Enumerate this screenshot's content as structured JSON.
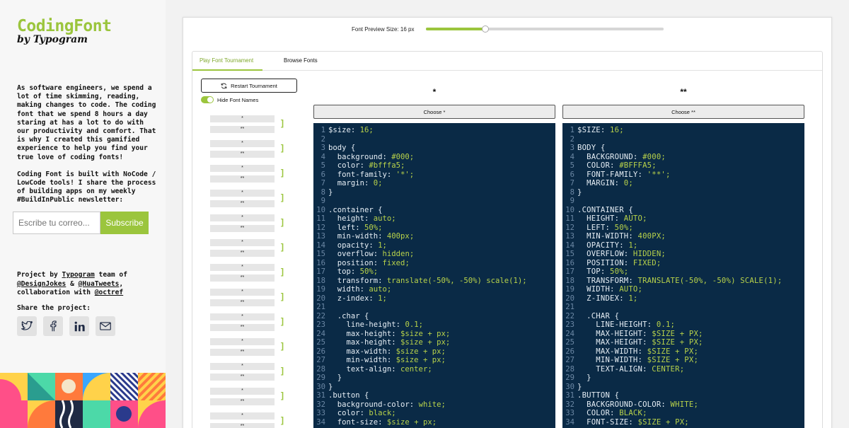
{
  "brand": {
    "name": "CodingFont",
    "byline": "by Typogram",
    "accent": "#9bc53d"
  },
  "sidebar": {
    "about_1": "As software engineers, we spend a lot of time skimming, reading, making changes to code. The coding font that we spend 8 hours a day staring at has a lot to do with our productivity and comfort. That is why I created this gamified experience to help you find your true love of coding fonts!",
    "about_2": "Coding Font is built with NoCode / LowCode tools! I share the process of building apps on my weekly #BuildInPublic newsletter:",
    "email_placeholder": "Escribe tu correo...",
    "subscribe_label": "Subscribe",
    "credits": {
      "prefix": "Project by ",
      "typogram": "Typogram",
      "team_of": " team of",
      "designjokes": "@DesignJokes",
      "amp": " & ",
      "huatweets": "@HuaTweets",
      "comma": ",",
      "collab": "collaboration with ",
      "octref": "@octref"
    },
    "share_title": "Share the project:",
    "share_icons": [
      "twitter-icon",
      "facebook-icon",
      "linkedin-icon",
      "mail-icon"
    ]
  },
  "preview": {
    "label": "Font Preview Size: 16 px",
    "size_fraction": 0.25
  },
  "tabs": [
    "Play Font Tournament",
    "Browse Fonts"
  ],
  "controls": {
    "restart_label": "Restart Tournament",
    "hide_names_label": "Hide Font Names",
    "hide_names_on": true
  },
  "bracket": {
    "rows": [
      [
        "*",
        "**"
      ],
      [
        "*",
        "**"
      ],
      [
        "*",
        "**"
      ],
      [
        "*",
        "**"
      ],
      [
        "*",
        "**"
      ],
      [
        "*",
        "**"
      ],
      [
        "*",
        "**"
      ],
      [
        "*",
        "**"
      ],
      [
        "*",
        "**"
      ],
      [
        "*",
        "**"
      ],
      [
        "*",
        "**"
      ],
      [
        "*",
        "**"
      ],
      [
        "*",
        "**"
      ]
    ],
    "mark": "]"
  },
  "compare": {
    "left": {
      "heading": "*",
      "choose_label": "Choose *"
    },
    "right": {
      "heading": "**",
      "choose_label": "Choose **"
    }
  },
  "code_lines": [
    "$size: 16;",
    "",
    "body {",
    "  background: #000;",
    "  color: #bfffa5;",
    "  font-family: '*';",
    "  margin: 0;",
    "}",
    "",
    ".container {",
    "  height: auto;",
    "  left: 50%;",
    "  min-width: 400px;",
    "  opacity: 1;",
    "  overflow: hidden;",
    "  position: fixed;",
    "  top: 50%;",
    "  transform: translate(-50%, -50%) scale(1);",
    "  width: auto;",
    "  z-index: 1;",
    "",
    "  .char {",
    "    line-height: 0.1;",
    "    max-height: $size + px;",
    "    max-height: $size + px;",
    "    max-width: $size + px;",
    "    min-width: $size + px;",
    "    text-align: center;",
    "  }",
    "}",
    ".button {",
    "  background-color: white;",
    "  color: black;",
    "  font-size: $size + px;"
  ],
  "code_lines_right": [
    "$size: 16;",
    "",
    "body {",
    "  background: #000;",
    "  color: #bfffa5;",
    "  font-family: '**';",
    "  margin: 0;",
    "}",
    "",
    ".container {",
    "  height: auto;",
    "  left: 50%;",
    "  min-width: 400px;",
    "  opacity: 1;",
    "  overflow: hidden;",
    "  position: fixed;",
    "  top: 50%;",
    "  transform: translate(-50%, -50%) scale(1);",
    "  width: auto;",
    "  z-index: 1;",
    "",
    "  .char {",
    "    line-height: 0.1;",
    "    max-height: $size + px;",
    "    max-height: $size + px;",
    "    max-width: $size + px;",
    "    min-width: $size + px;",
    "    text-align: center;",
    "  }",
    "}",
    ".button {",
    "  background-color: white;",
    "  color: black;",
    "  font-size: $size + px;"
  ],
  "code_colors": {
    "background": "#0a2a46",
    "text": "#e6eef5",
    "value": "#b8d24a",
    "line_number": "#6b87a4"
  }
}
